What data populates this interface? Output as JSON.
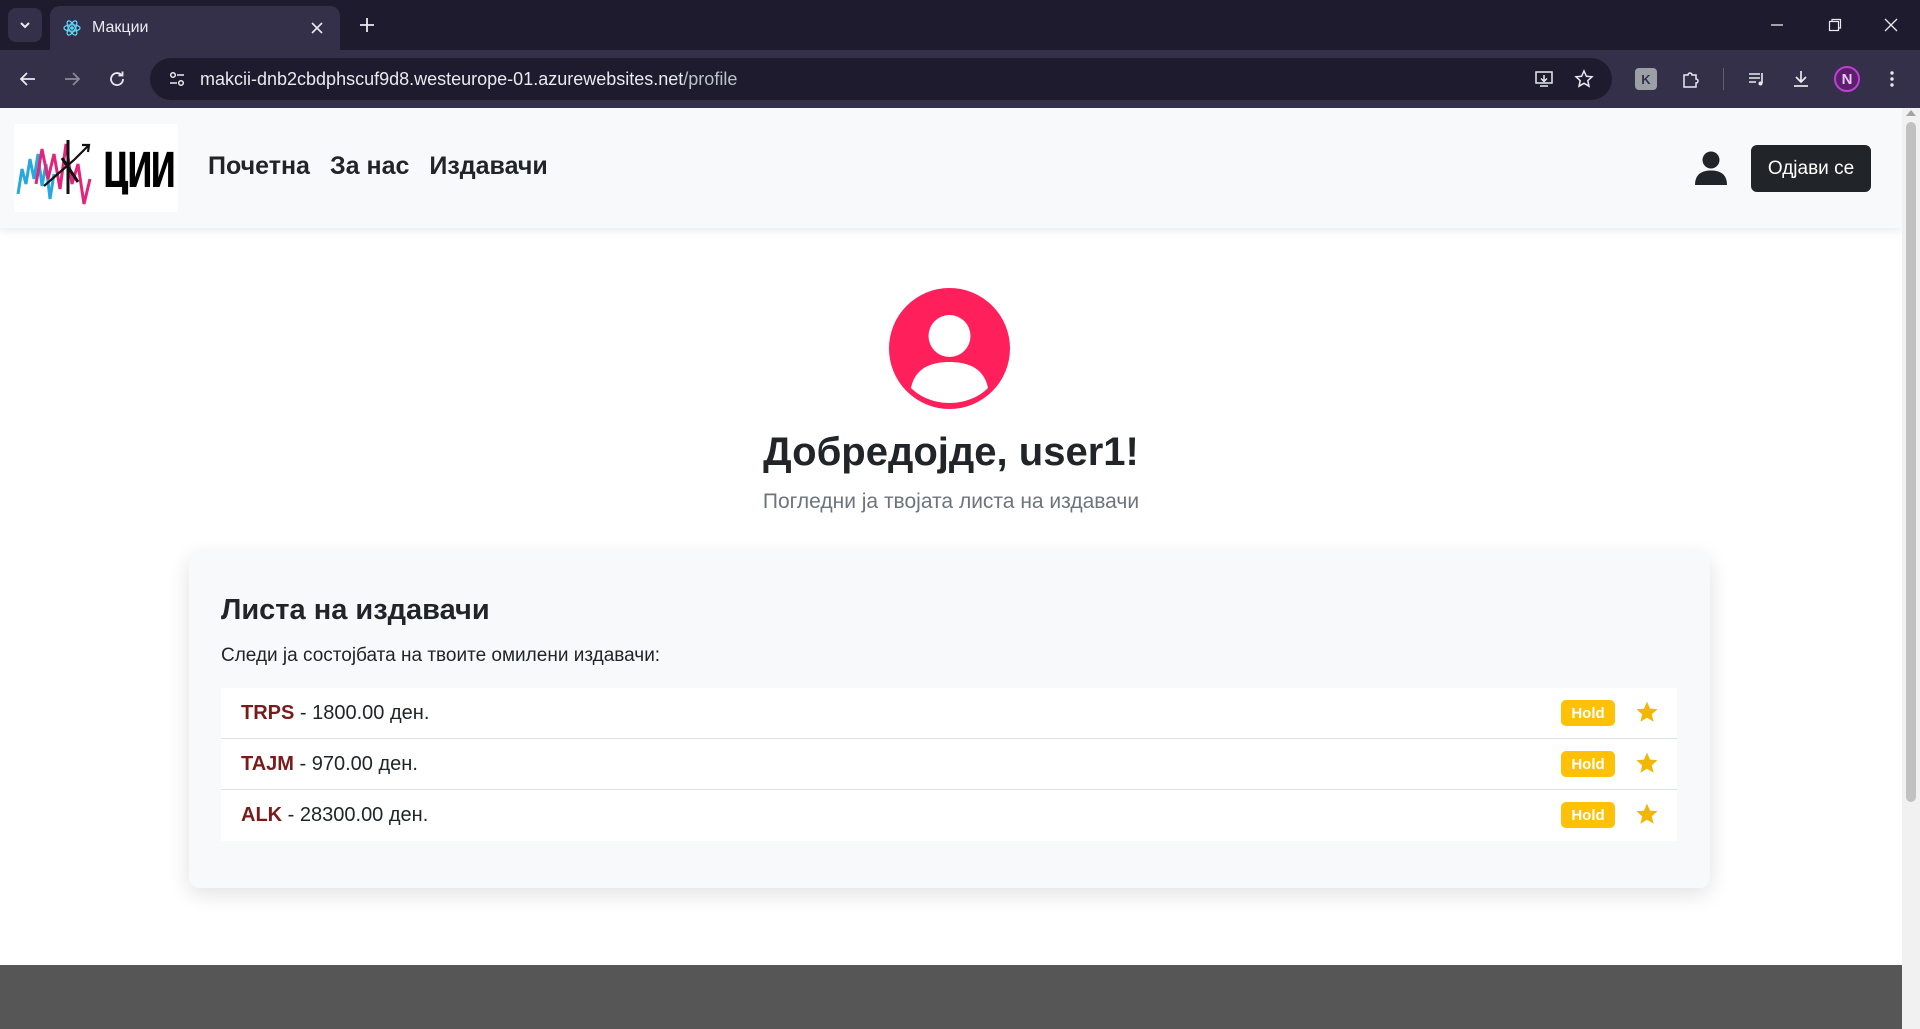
{
  "browser": {
    "tab_title": "Макции",
    "url_host": "makcii-dnb2cbdphscuf9d8.westeurope-01.azurewebsites.net",
    "url_path": "/profile",
    "profile_initial": "N",
    "extension_initial": "K"
  },
  "navbar": {
    "logo_text": "ЦИИ",
    "links": [
      "Почетна",
      "За нас",
      "Издавачи"
    ],
    "logout_label": "Одјави се"
  },
  "profile": {
    "welcome": "Добредојде, user1!",
    "subtitle": "Погледни ја твојата листа на издавачи",
    "avatar_color": "#ff1f5a"
  },
  "watchlist": {
    "title": "Листа на издавачи",
    "description": "Следи ја состојбата на твоите омилени издавачи:",
    "items": [
      {
        "ticker": "TRPS",
        "separator": " - ",
        "price": "1800.00 ден.",
        "badge": "Hold"
      },
      {
        "ticker": "TAJM",
        "separator": " - ",
        "price": "970.00 ден.",
        "badge": "Hold"
      },
      {
        "ticker": "ALK",
        "separator": " - ",
        "price": "28300.00 ден.",
        "badge": "Hold"
      }
    ]
  },
  "colors": {
    "badge": "#ffc107",
    "star": "#f2b705",
    "ticker": "#7a1b1b",
    "logout_bg": "#212529"
  }
}
